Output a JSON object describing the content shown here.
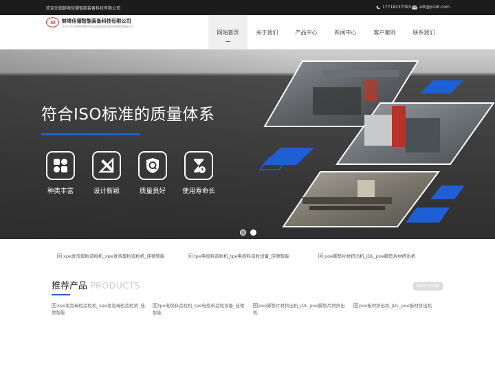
{
  "topbar": {
    "welcome": "欢迎光临蚌埠佳德智能装备科技有限公司",
    "phone": "17718237093",
    "email": "zdt@jnzdl.com"
  },
  "header": {
    "logo_mark": "JD",
    "company_name": "蚌埠佳德智能装备科技有限公司",
    "company_slogan": "专业于生产各种特殊挤出机高效混炼机等先进制造装备企业"
  },
  "nav": {
    "items": [
      {
        "label": "网站首页",
        "active": true
      },
      {
        "label": "关于我们",
        "active": false
      },
      {
        "label": "产品中心",
        "active": false
      },
      {
        "label": "新闻中心",
        "active": false
      },
      {
        "label": "客户案例",
        "active": false
      },
      {
        "label": "联系我们",
        "active": false
      }
    ]
  },
  "banner": {
    "title": "符合ISO标准的质量体系",
    "features": [
      {
        "label": "种类丰富",
        "icon": "grid-icon"
      },
      {
        "label": "设计新颖",
        "icon": "design-tools-icon"
      },
      {
        "label": "质量良好",
        "icon": "quality-badge-icon"
      },
      {
        "label": "使用寿命长",
        "icon": "hourglass-icon"
      }
    ],
    "slides": 2,
    "active_slide": 2,
    "accent_color": "#1f5fd6"
  },
  "thumbs": [
    "xpe发泡母粒造粒机_xpe发泡母粒造粒机_佳德智能",
    "tpe电缆料造粒机_tpe电缆料造粒设备_佳德智能",
    "poe脚垫片材挤出机_JDL_poe脚垫片材挤出机"
  ],
  "products_section": {
    "title_cn": "推荐产品",
    "title_en": "PRODUCTS",
    "read_more": "READ MORE",
    "items": [
      "xpe发泡母粒造粒机_xpe发泡母粒造粒机_佳德智能",
      "tpe电缆料造粒机_tpe电缆料造粒设备_佳德智能",
      "poe脚垫片材挤出机_JDL_poe脚垫片材挤出机",
      "poe板材挤出机_JDL_poe板材挤出机"
    ]
  },
  "colors": {
    "topbar_bg": "#1c1c1c",
    "accent": "#2a5bd7"
  }
}
